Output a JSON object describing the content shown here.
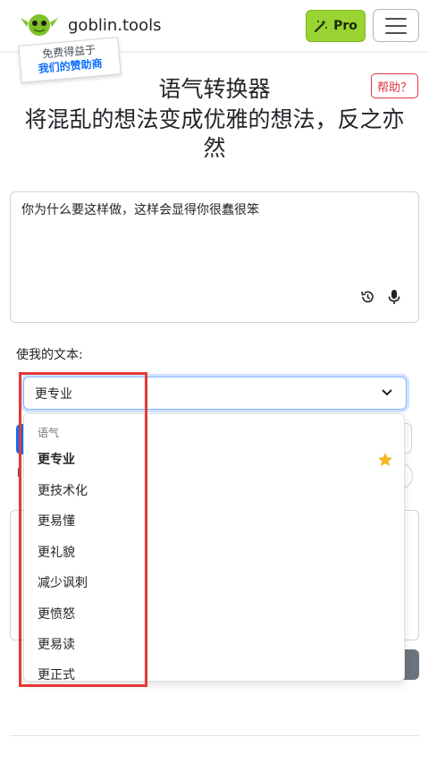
{
  "header": {
    "brand": "goblin.tools",
    "pro_label": "Pro"
  },
  "sponsor": {
    "line1": "免费得益于",
    "line2": "我们的赞助商"
  },
  "help_label": "帮助？",
  "page": {
    "title": "语气转换器",
    "subtitle": "将混乱的想法变成优雅的想法，反之亦然"
  },
  "input": {
    "value": "你为什么要这样做，这样会显得你很蠢很笨"
  },
  "make_label": "使我的文本:",
  "select": {
    "value": "更专业"
  },
  "dropdown": {
    "group_label": "语气",
    "options": [
      "更专业",
      "更技术化",
      "更易懂",
      "更礼貌",
      "减少讽刺",
      "更愤怒",
      "更易读",
      "更正式"
    ]
  },
  "background_fragment": "l",
  "colors": {
    "pro_green": "#9ad433",
    "primary": "#0d6efd",
    "danger": "#dc3545",
    "star": "#f2b824",
    "highlight": "#e53935"
  },
  "icons": [
    "goblin-logo",
    "magic-wand-icon",
    "menu-icon",
    "history-icon",
    "microphone-icon",
    "chevron-down-icon",
    "star-icon"
  ]
}
